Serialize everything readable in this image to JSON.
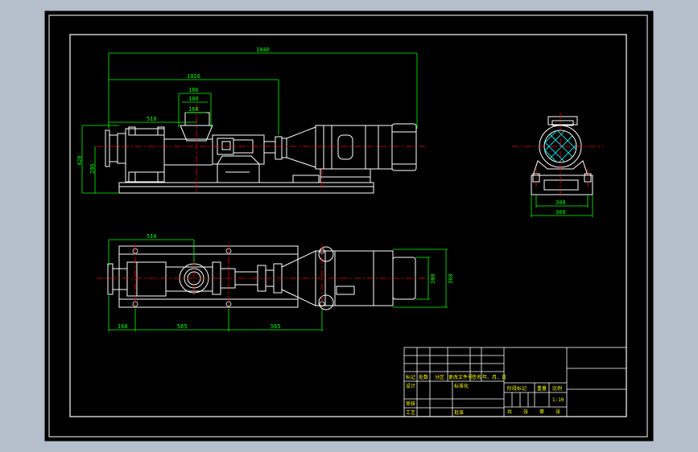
{
  "colors": {
    "background": "#b5bfcb",
    "sheet": "#000000",
    "outline": "#ffffff",
    "dimension": "#00ff00",
    "centerline": "#ff0000",
    "hatch": "#00ffff",
    "title_text": "#ffff00"
  },
  "dimensions": {
    "front_view": {
      "overall_length": "1840",
      "suction_to_motor": "1020",
      "flange_outer": "186",
      "flange_mid": "180",
      "flange_inner": "160",
      "inlet_offset": "510",
      "overall_height": "420",
      "center_height": "295"
    },
    "plan_view": {
      "inlet_offset": "510",
      "end_offset": "160",
      "bolt_spacing_1": "565",
      "bolt_spacing_2": "565",
      "base_width": "300",
      "overall_width": "360"
    },
    "side_view": {
      "bolt_spacing": "300",
      "base_width": "360"
    }
  },
  "title_block": {
    "header_row": [
      "标记",
      "处数",
      "分区",
      "更改文件号",
      "签名",
      "年、月、日"
    ],
    "designer_label": "设计",
    "standard_label": "标准化",
    "stage_label": "阶段标记",
    "weight_label": "重量",
    "scale_label": "比例",
    "scale_value": "1:10",
    "review_label": "审核",
    "process_label": "工艺",
    "approve_label": "批准",
    "sheet_row": [
      "共",
      "张",
      "第",
      "张"
    ]
  }
}
